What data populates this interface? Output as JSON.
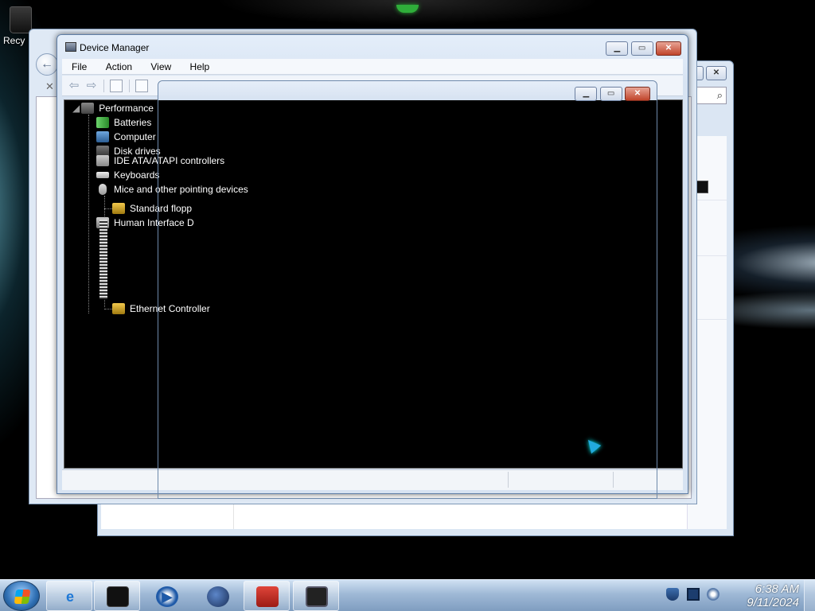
{
  "desktop": {
    "recycle_label": "Recy"
  },
  "window": {
    "title": "Device Manager",
    "menu": [
      "File",
      "Action",
      "View",
      "Help"
    ]
  },
  "tree": {
    "root": "Performance",
    "items": [
      {
        "label": "Batteries",
        "icon": "battery-icon"
      },
      {
        "label": "Computer",
        "icon": "computer-icon"
      },
      {
        "label": "Disk drives",
        "icon": "disk-drive-icon"
      },
      {
        "label": "IDE ATA/ATAPI controllers",
        "icon": "ide-controller-icon"
      },
      {
        "label": "Keyboards",
        "icon": "keyboard-icon"
      },
      {
        "label": "Mice and other pointing devices",
        "icon": "mouse-icon"
      },
      {
        "label": "Standard flopp",
        "icon": "warning-device-icon"
      },
      {
        "label": "Human Interface D",
        "icon": "hid-icon"
      },
      {
        "label": "Ethernet Controller",
        "icon": "warning-device-icon"
      }
    ]
  },
  "taskbar": {
    "time": "6:38 AM",
    "date": "9/11/2024",
    "apps": [
      "internet-explorer-icon",
      "black-window-icon",
      "media-player-icon",
      "globe-icon",
      "toolbox-icon",
      "monitor-icon"
    ]
  },
  "colors": {
    "accent": "#2a9fd8",
    "warning": "#f2c94c",
    "content_bg": "#000000"
  }
}
